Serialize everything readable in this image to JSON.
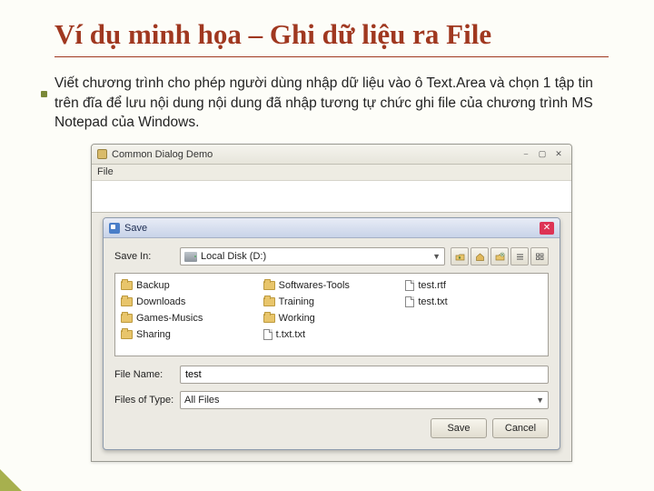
{
  "slide": {
    "title": "Ví dụ minh họa – Ghi dữ liệu ra File",
    "body": "Viết chương trình cho phép người dùng nhập dữ liệu vào ô Text.Area và chọn 1 tập tin trên đĩa để lưu nội dung nội dung đã nhập tương tự chức ghi file của chương trình MS Notepad của Windows."
  },
  "app": {
    "title": "Common Dialog Demo",
    "menu": {
      "file": "File"
    },
    "ctl": {
      "min": "⎯",
      "max": "▢",
      "close": "✕"
    }
  },
  "dialog": {
    "title": "Save",
    "close": "✕",
    "save_in_label": "Save In:",
    "save_in_value": "Local Disk (D:)",
    "file_name_label": "File Name:",
    "file_name_value": "test",
    "type_label": "Files of Type:",
    "type_value": "All Files",
    "btn_save": "Save",
    "btn_cancel": "Cancel",
    "items": {
      "backup": "Backup",
      "downloads": "Downloads",
      "games": "Games-Musics",
      "sharing": "Sharing",
      "soft": "Softwares-Tools",
      "training": "Training",
      "working": "Working",
      "txt1": "t.txt.txt",
      "rtf": "test.rtf",
      "txt2": "test.txt"
    }
  }
}
